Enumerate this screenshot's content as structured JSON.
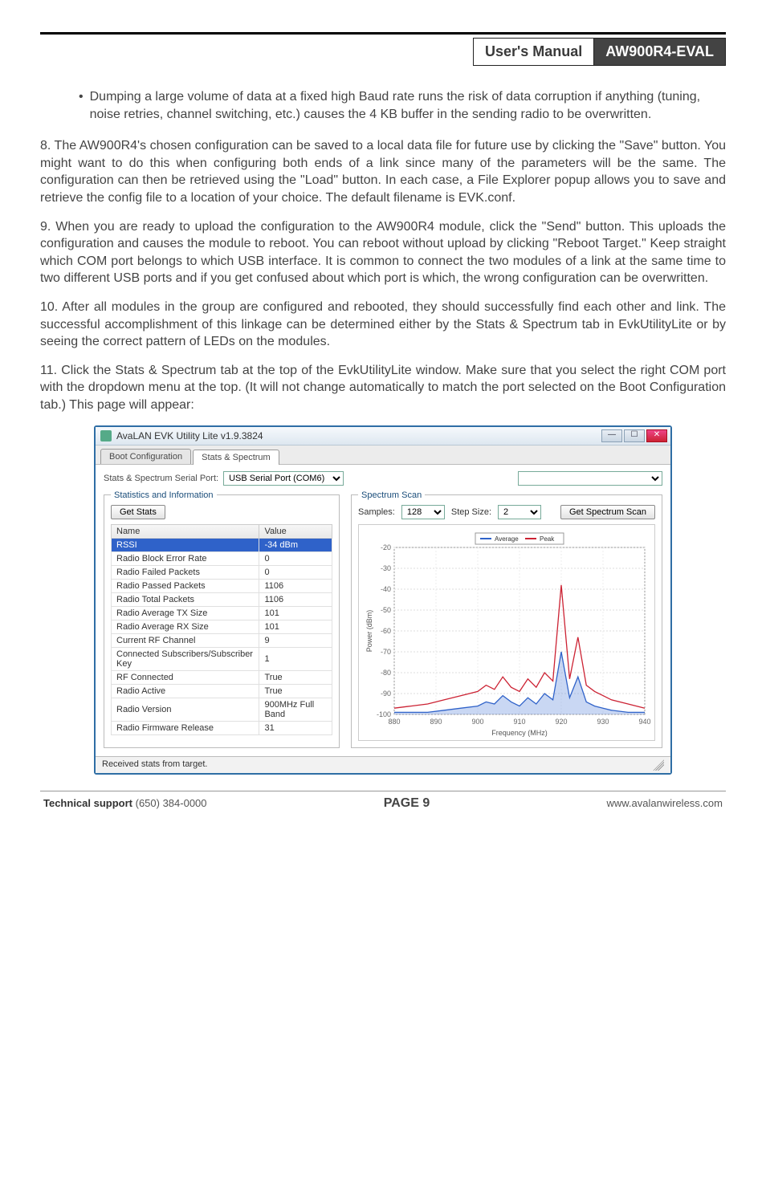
{
  "header": {
    "left": "User's Manual",
    "right": "AW900R4-EVAL"
  },
  "bullet1": "Dumping a large volume of data at a fixed high Baud rate runs the risk of data corruption if anything (tuning, noise retries, channel switching, etc.) causes the 4 KB buffer in the sending radio to be overwritten.",
  "para8": "8. The AW900R4's chosen configuration can be saved to a local data file for future use by clicking the \"Save\" button. You might want to do this when configuring both ends of a link since many of the parameters will be the same. The configuration can then be retrieved using the \"Load\" button. In each case, a File Explorer popup allows you to save and retrieve the config file to a location of your choice. The default filename is EVK.conf.",
  "para9": "9. When you are ready to upload the configuration to the AW900R4 module, click the \"Send\" button. This uploads the configuration and causes the module to reboot. You can reboot without upload by clicking \"Reboot Target.\" Keep straight which COM port belongs to which USB interface. It is common to connect the two modules of a link at the same time to two different USB ports and if you get confused about which port is which, the wrong configuration can be overwritten.",
  "para10": "10. After all modules in the group are configured and rebooted, they should successfully find each other and link.  The successful accomplishment of this linkage can be determined either by the Stats & Spectrum tab in EvkUtilityLite or by seeing the correct pattern of LEDs on the modules.",
  "para11": "11. Click the Stats & Spectrum tab at the top of the EvkUtilityLite window. Make sure that you select the right COM port with the dropdown menu at the top. (It will not change automatically to match the port selected on the Boot Configuration tab.) This page will appear:",
  "app": {
    "title": "AvaLAN EVK Utility Lite v1.9.3824",
    "tabs": {
      "boot": "Boot Configuration",
      "stats": "Stats & Spectrum"
    },
    "port_label": "Stats & Spectrum Serial Port:",
    "port_value": "USB Serial Port (COM6)",
    "secondary_port_value": "",
    "stats_panel": {
      "legend": "Statistics and Information",
      "get_stats": "Get Stats",
      "columns": {
        "name": "Name",
        "value": "Value"
      },
      "rows": [
        {
          "name": "RSSI",
          "value": "-34 dBm",
          "selected": true
        },
        {
          "name": "Radio Block Error Rate",
          "value": "0"
        },
        {
          "name": "Radio Failed Packets",
          "value": "0"
        },
        {
          "name": "Radio Passed Packets",
          "value": "1106"
        },
        {
          "name": "Radio Total Packets",
          "value": "1106"
        },
        {
          "name": "Radio Average TX Size",
          "value": "101"
        },
        {
          "name": "Radio Average RX Size",
          "value": "101"
        },
        {
          "name": "Current RF Channel",
          "value": "9"
        },
        {
          "name": "Connected Subscribers/Subscriber Key",
          "value": "1"
        },
        {
          "name": "RF Connected",
          "value": "True"
        },
        {
          "name": "Radio Active",
          "value": "True"
        },
        {
          "name": "Radio Version",
          "value": "900MHz Full Band"
        },
        {
          "name": "Radio Firmware Release",
          "value": "31"
        }
      ]
    },
    "scan_panel": {
      "legend": "Spectrum Scan",
      "samples_label": "Samples:",
      "samples_value": "128",
      "step_label": "Step Size:",
      "step_value": "2",
      "button": "Get Spectrum Scan",
      "legend_avg": "Average",
      "legend_peak": "Peak",
      "ylabel": "Power (dBm)",
      "xlabel": "Frequency (MHz)"
    },
    "status": "Received stats from target."
  },
  "chart_data": {
    "type": "line",
    "title": "",
    "xlabel": "Frequency (MHz)",
    "ylabel": "Power (dBm)",
    "ylim": [
      -100,
      -20
    ],
    "xlim": [
      880,
      940
    ],
    "xticks": [
      880,
      890,
      900,
      910,
      920,
      930,
      940
    ],
    "yticks": [
      -20,
      -30,
      -40,
      -50,
      -60,
      -70,
      -80,
      -90,
      -100
    ],
    "series": [
      {
        "name": "Average",
        "color": "#2f62c9",
        "values_x": [
          880,
          884,
          888,
          892,
          896,
          900,
          902,
          904,
          906,
          908,
          910,
          912,
          914,
          916,
          918,
          920,
          922,
          924,
          926,
          928,
          930,
          932,
          936,
          940
        ],
        "values_y": [
          -99,
          -99,
          -99,
          -98,
          -97,
          -96,
          -94,
          -95,
          -91,
          -94,
          -96,
          -92,
          -95,
          -90,
          -93,
          -70,
          -92,
          -82,
          -94,
          -96,
          -97,
          -98,
          -99,
          -99
        ]
      },
      {
        "name": "Peak",
        "color": "#c23",
        "values_x": [
          880,
          884,
          888,
          892,
          896,
          900,
          902,
          904,
          906,
          908,
          910,
          912,
          914,
          916,
          918,
          920,
          922,
          924,
          926,
          928,
          930,
          932,
          936,
          940
        ],
        "values_y": [
          -97,
          -96,
          -95,
          -93,
          -91,
          -89,
          -86,
          -88,
          -82,
          -87,
          -89,
          -83,
          -87,
          -80,
          -84,
          -38,
          -83,
          -63,
          -86,
          -89,
          -91,
          -93,
          -95,
          -97
        ]
      }
    ]
  },
  "footer": {
    "support_label": "Technical support",
    "support_phone": " (650) 384-0000",
    "page": "PAGE 9",
    "url": "www.avalanwireless.com"
  }
}
